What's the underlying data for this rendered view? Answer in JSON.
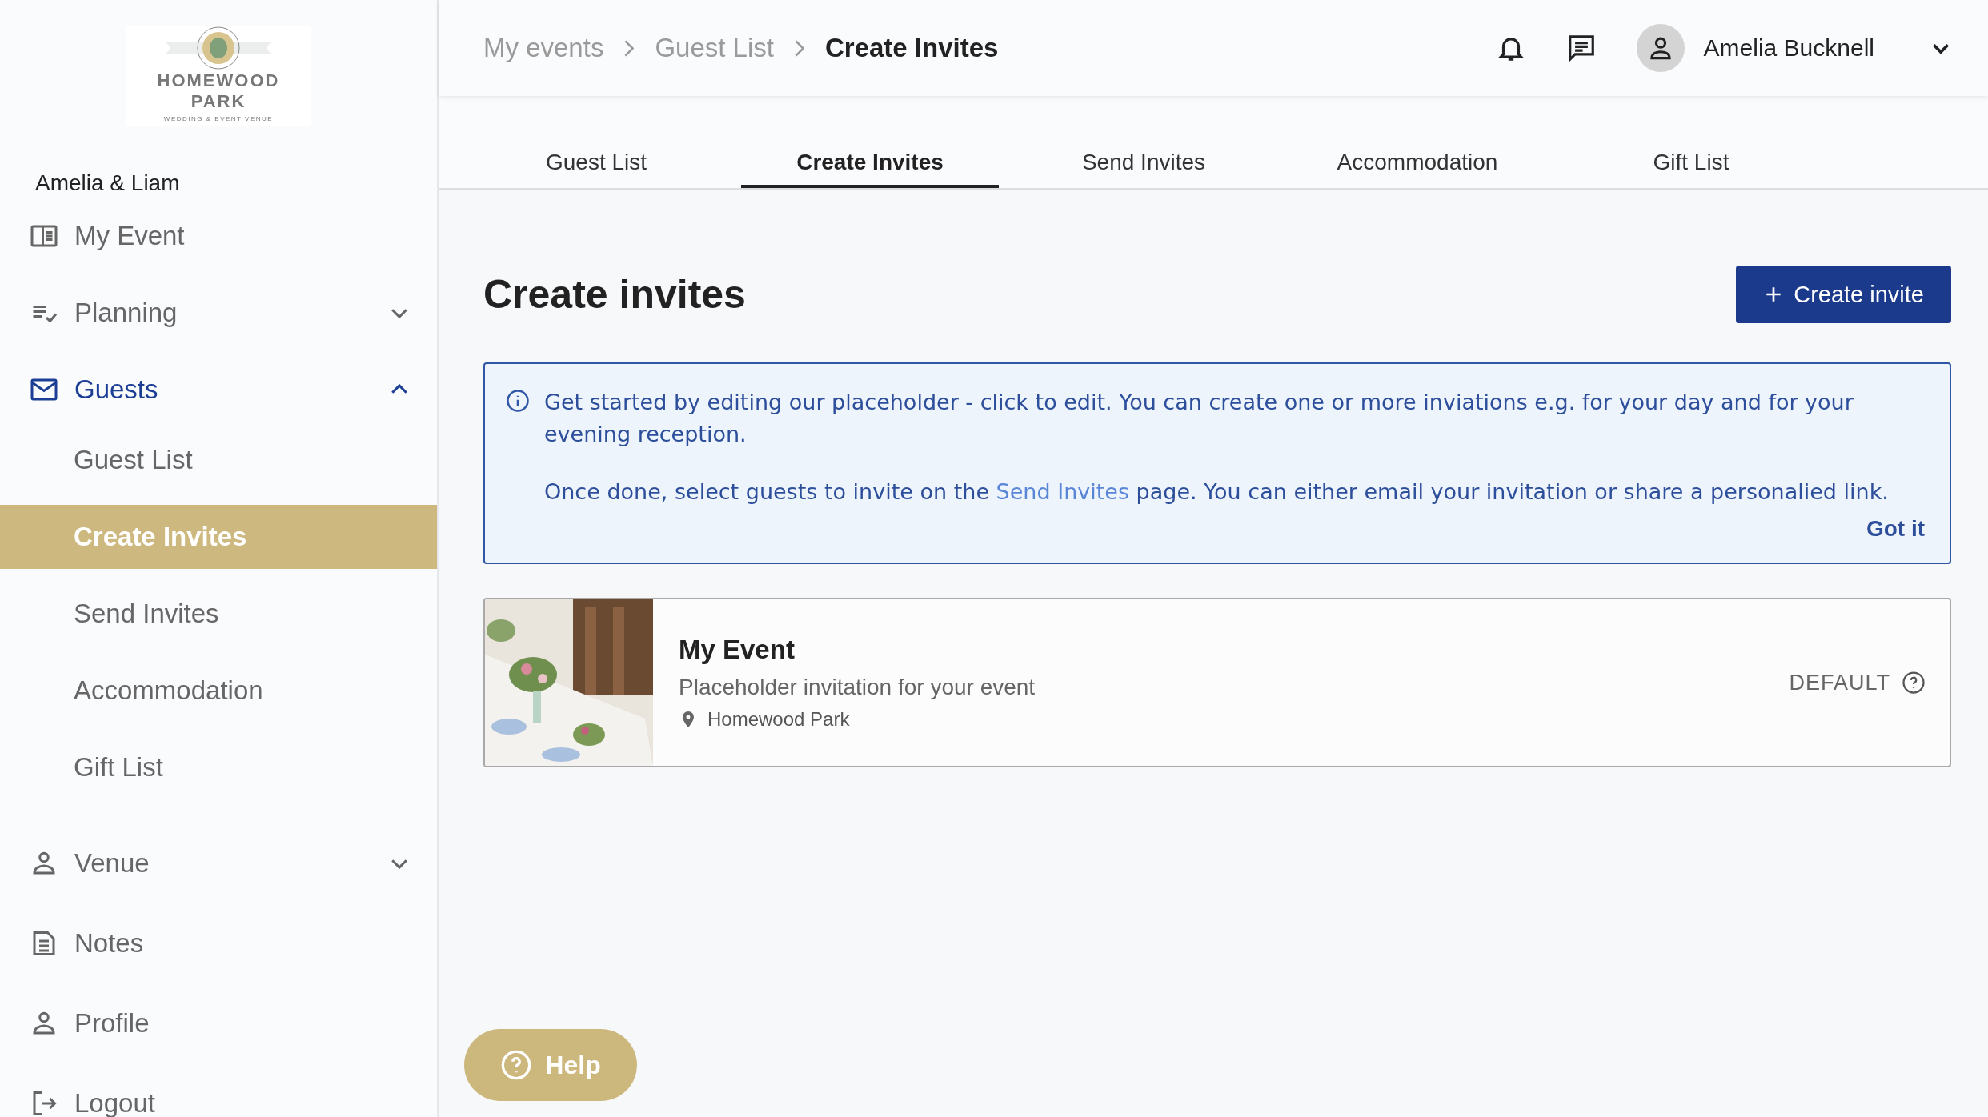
{
  "logo": {
    "line_1": "HOMEWOOD",
    "line_2": "PARK",
    "tagline": "WEDDING & EVENT VENUE"
  },
  "couple": "Amelia & Liam",
  "sidebar": {
    "items": [
      {
        "label": "My Event",
        "kind": "link",
        "selected": false
      },
      {
        "label": "Planning",
        "kind": "group",
        "selected": false,
        "expanded": false
      },
      {
        "label": "Guests",
        "kind": "group",
        "selected": true,
        "expanded": true,
        "children": [
          {
            "label": "Guest List",
            "selected": false
          },
          {
            "label": "Create Invites",
            "selected": true
          },
          {
            "label": "Send Invites",
            "selected": false
          },
          {
            "label": "Accommodation",
            "selected": false
          },
          {
            "label": "Gift List",
            "selected": false
          }
        ]
      },
      {
        "label": "Venue",
        "kind": "group",
        "selected": false,
        "expanded": false
      },
      {
        "label": "Notes",
        "kind": "link",
        "selected": false
      },
      {
        "label": "Profile",
        "kind": "link",
        "selected": false
      },
      {
        "label": "Logout",
        "kind": "link",
        "selected": false
      }
    ]
  },
  "help_button": "Help",
  "breadcrumb": [
    {
      "label": "My events",
      "current": false
    },
    {
      "label": "Guest List",
      "current": false
    },
    {
      "label": "Create Invites",
      "current": true
    }
  ],
  "user": {
    "name": "Amelia Bucknell"
  },
  "tabs": [
    {
      "label": "Guest List",
      "selected": false
    },
    {
      "label": "Create Invites",
      "selected": true
    },
    {
      "label": "Send Invites",
      "selected": false
    },
    {
      "label": "Accommodation",
      "selected": false
    },
    {
      "label": "Gift List",
      "selected": false
    }
  ],
  "page_title": "Create invites",
  "create_button": "Create invite",
  "info": {
    "paragraph_1": "Get started by editing our placeholder - click to edit. You can create one or more inviations e.g. for your day and for your evening reception.",
    "paragraph_2": {
      "before": "Once done, select guests to invite on the ",
      "link": "Send Invites",
      "after": " page. You can either email your invitation or share a personalied link."
    },
    "dismiss": "Got it"
  },
  "invitations": [
    {
      "title": "My Event",
      "description": "Placeholder invitation for your event",
      "location": "Homewood Park",
      "badge": "DEFAULT"
    }
  ]
}
